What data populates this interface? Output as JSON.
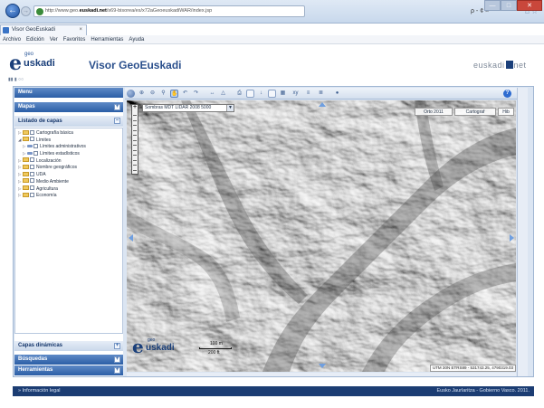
{
  "browser": {
    "url_prefix": "http://www.geo.",
    "url_host": "euskadi.net",
    "url_path": "/s69-bisorea/es/x72aGeoeuskadiWAR/index.jsp",
    "search_label": "ρ - ¢ ×",
    "tab_label": "Visor GeoEuskadi",
    "menu": [
      "Archivo",
      "Edición",
      "Ver",
      "Favoritos",
      "Herramientas",
      "Ayuda"
    ]
  },
  "header": {
    "logo_geo": "geo",
    "logo_e": "e",
    "logo_uskadi": "uskadi",
    "title": "Visor GeoEuskadi",
    "gov_logo_left": "euskadi",
    "gov_logo_right": "net"
  },
  "sidebar": {
    "menu_label": "Menu",
    "mapas_label": "Mapas",
    "capas_label": "Listado de capas",
    "dinamicas_label": "Capas dinámicas",
    "busquedas_label": "Búsquedas",
    "herramientas_label": "Herramientas",
    "tree": [
      {
        "label": "Cartografía básica",
        "level": 0,
        "expander": "▷"
      },
      {
        "label": "Límites",
        "level": 0,
        "expander": "◢"
      },
      {
        "label": "Límites administrativos",
        "level": 1,
        "expander": "▷"
      },
      {
        "label": "Límites estadísticos",
        "level": 1,
        "expander": "▷"
      },
      {
        "label": "Localización",
        "level": 0,
        "expander": "▷"
      },
      {
        "label": "Nombre geográficos",
        "level": 0,
        "expander": "▷"
      },
      {
        "label": "UDA",
        "level": 0,
        "expander": "▷"
      },
      {
        "label": "Medio Ambiente",
        "level": 0,
        "expander": "▷"
      },
      {
        "label": "Agricultura",
        "level": 0,
        "expander": "▷"
      },
      {
        "label": "Economía",
        "level": 0,
        "expander": "▷"
      }
    ]
  },
  "map": {
    "layer_select_value": "Sombras MDT LIDAR 2008 5000",
    "base_buttons": [
      "Orto 2011",
      "Cartograf",
      "Hib"
    ],
    "logo_geo": "geo",
    "logo_e": "e",
    "logo_uskadi": "uskadi",
    "scale_top": "100 m",
    "scale_bottom": "200 ft",
    "coords": "UTM 30N ETRS89 - 531743.25, 4790319.03",
    "help_label": "?"
  },
  "footer": {
    "legal": "»  Información legal",
    "copyright": "Eusko Jaurlaritza - Gobierno Vasco. 2011."
  }
}
